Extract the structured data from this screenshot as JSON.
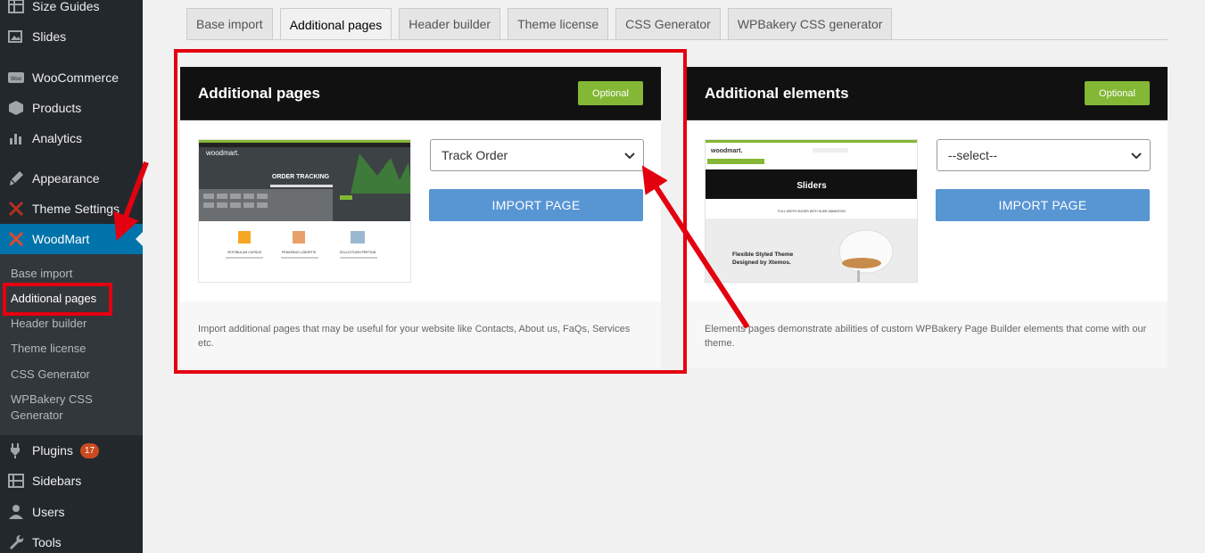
{
  "sidebar": {
    "items": [
      {
        "label": "Size Guides",
        "icon": "grid-icon"
      },
      {
        "label": "Slides",
        "icon": "slides-icon"
      },
      {
        "label": "WooCommerce",
        "icon": "woocommerce-icon"
      },
      {
        "label": "Products",
        "icon": "box-icon"
      },
      {
        "label": "Analytics",
        "icon": "bar-chart-icon"
      },
      {
        "label": "Appearance",
        "icon": "paintbrush-icon"
      },
      {
        "label": "Theme Settings",
        "icon": "woodmart-logo-icon"
      },
      {
        "label": "WoodMart",
        "icon": "woodmart-logo-icon"
      },
      {
        "label": "Plugins",
        "icon": "plug-icon",
        "badge": "17"
      },
      {
        "label": "Sidebars",
        "icon": "sidebars-icon"
      },
      {
        "label": "Users",
        "icon": "user-icon"
      },
      {
        "label": "Tools",
        "icon": "wrench-icon"
      }
    ],
    "submenu": [
      "Base import",
      "Additional pages",
      "Header builder",
      "Theme license",
      "CSS Generator",
      "WPBakery CSS Generator"
    ]
  },
  "tabs": [
    "Base import",
    "Additional pages",
    "Header builder",
    "Theme license",
    "CSS Generator",
    "WPBakery CSS generator"
  ],
  "active_tab": "Additional pages",
  "cards": [
    {
      "title": "Additional pages",
      "badge": "Optional",
      "select_value": "Track Order",
      "button": "IMPORT PAGE",
      "description": "Import additional pages that may be useful for your website like Contacts, About us, FaQs, Services etc.",
      "thumb": {
        "logo": "woodmart.",
        "heading": "ORDER TRACKING",
        "features": [
          "VESTIBULUM CURSUS",
          "PENATIBUS LOBORTIS",
          "SOLLICITUDIN PRETIUM"
        ]
      }
    },
    {
      "title": "Additional elements",
      "badge": "Optional",
      "select_value": "--select--",
      "button": "IMPORT PAGE",
      "description": "Elements pages demonstrate abilities of custom WPBakery Page Builder elements that come with our theme.",
      "thumb": {
        "logo": "woodmart.",
        "heading": "Sliders",
        "subheading": "FULL WIDTH SLIDER WITH SLIDE ANIMATION",
        "promo": "Flexible Styled Theme Designed by Xtemos."
      }
    }
  ],
  "colors": {
    "sidebar_bg": "#23282d",
    "active_menu": "#0073aa",
    "badge_green": "#83b735",
    "import_button": "#5795d3",
    "annotation_red": "#e3000f"
  }
}
